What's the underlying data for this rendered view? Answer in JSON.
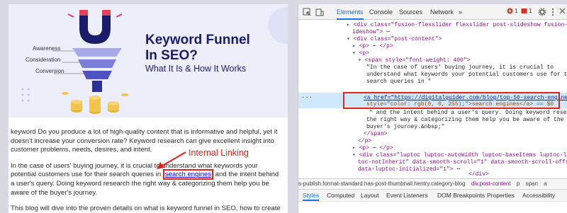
{
  "webpage": {
    "hero": {
      "title_line1": "Keyword Funnel",
      "title_line2": "In SEO?",
      "subtitle": "What It Is & How It Works",
      "funnel_labels": [
        "Awareness",
        "Consideration",
        "Conversion"
      ]
    },
    "paragraph1": "keyword Do you produce a lot of high-quality content that is informative and helpful, yet it doesn't increase your conversion rate? Keyword research can give excellent insight into customer problems, needs, desires, and intent.",
    "paragraph2_before": "In the case of users' buying journey, it is crucial to understand what keywords your potential customers use for their search queries in ",
    "paragraph2_link": "search engines",
    "paragraph2_after": " and the intent behind a user's query. Doing keyword research the right way & categorizing them help you be aware of the buyer's journey.",
    "paragraph3": "This blog will dive into the proven details on what is keyword funnel in SEO, how to create",
    "annotation": "Internal Linking",
    "colors": {
      "annotation_red": "#e2231a",
      "link_blue": "#0000ff",
      "hero_navy": "#1b1b6b"
    }
  },
  "devtools": {
    "tabs": [
      "Elements",
      "Console",
      "Sources",
      "Network",
      "»"
    ],
    "active_tab": "Elements",
    "error_count": "1",
    "warning_count": "1",
    "code_lines": [
      "<div class=\"fusion-flexslider flexslider post-slideshow fusion-post-sl",
      "ideshow\">",
      "<div class=\"post-content\">",
      "<p>",
      "<p>",
      "<span style=\"font-weight: 400\">",
      "\"In the case of users' buying journey, it is crucial to",
      "understand what keywords your potential customers use for their",
      "search queries in \"",
      "<a href=\"https://digitalguider.com/blog/top-50-search-engines/\"",
      "style=\"color: rgb(0, 0, 255);\">search engines</a> == $0",
      "\" and the intent behind a user's query. Doing keyword research",
      "the right way & categorizing them help you be aware of the",
      "buyer's journey.&nbsp;\"",
      "</span>",
      "</p>",
      "<p>",
      "<div class=\"luptoc luptoc-autoWidth luptoc-baseItems luptoc-light lu",
      "toc-notInherit\" data-smooth-scroll=\"1\" data-smooth-scroll-offset=\"24",
      "data-luptoc-initialized=\"1\">",
      "</div>"
    ],
    "breadcrumb": [
      "s-publish.format-standard.has-post-thumbnail.hentry.category-blog",
      "div.post-content",
      "p",
      "span",
      "a"
    ],
    "sub_tabs": [
      "Styles",
      "Computed",
      "Layout",
      "Event Listeners",
      "DOM Breakpoints",
      "Properties",
      "Accessibility"
    ],
    "active_sub_tab": "Styles"
  }
}
